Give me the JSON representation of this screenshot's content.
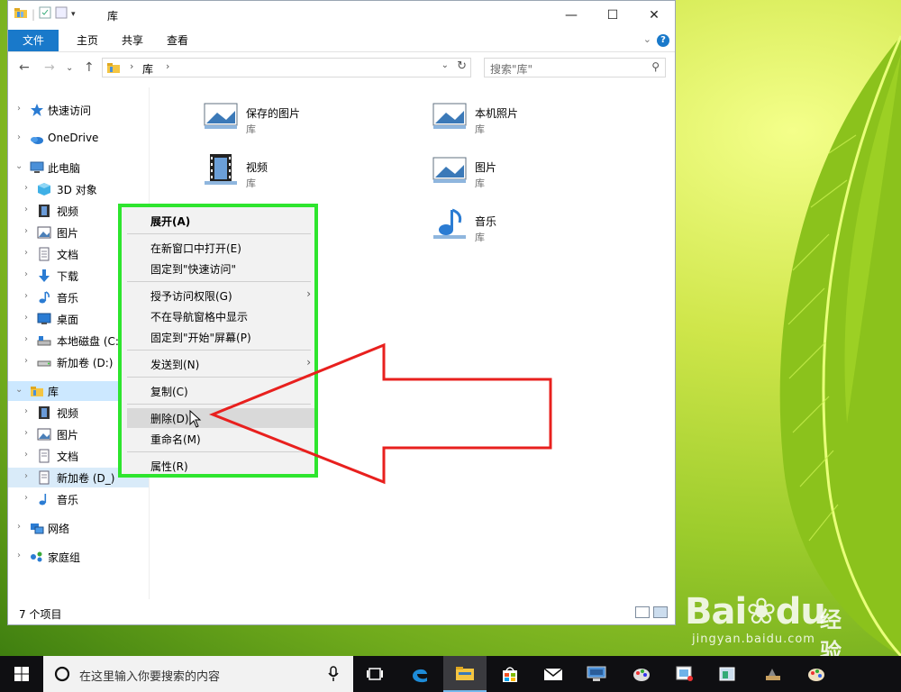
{
  "window": {
    "title": "库",
    "buttons": [
      "—",
      "☐",
      "✕"
    ]
  },
  "ribbon": {
    "tabs": [
      "文件",
      "主页",
      "共享",
      "查看"
    ]
  },
  "address": {
    "path": "库",
    "search_placeholder": "搜索\"库\""
  },
  "nav": {
    "items": [
      {
        "label": "快速访问",
        "icon": "star-icon"
      },
      {
        "label": "OneDrive",
        "icon": "cloud-icon"
      },
      {
        "label": "此电脑",
        "icon": "computer-icon"
      },
      {
        "label": "3D 对象",
        "icon": "cube-icon"
      },
      {
        "label": "视频",
        "icon": "film-icon"
      },
      {
        "label": "图片",
        "icon": "picture-icon"
      },
      {
        "label": "文档",
        "icon": "document-icon"
      },
      {
        "label": "下载",
        "icon": "download-icon"
      },
      {
        "label": "音乐",
        "icon": "music-icon"
      },
      {
        "label": "桌面",
        "icon": "desktop-icon"
      },
      {
        "label": "本地磁盘 (C:",
        "icon": "disk-icon"
      },
      {
        "label": "新加卷 (D:)",
        "icon": "drive-icon"
      },
      {
        "label": "库",
        "icon": "library-icon"
      },
      {
        "label": "视频",
        "icon": "film-icon"
      },
      {
        "label": "图片",
        "icon": "picture-icon"
      },
      {
        "label": "文档",
        "icon": "document-icon"
      },
      {
        "label": "新加卷 (D_)",
        "icon": "document-icon"
      },
      {
        "label": "音乐",
        "icon": "music-icon"
      },
      {
        "label": "网络",
        "icon": "network-icon"
      },
      {
        "label": "家庭组",
        "icon": "homegroup-icon"
      }
    ]
  },
  "content": {
    "tiles": [
      {
        "name": "保存的图片",
        "sub": "库",
        "icon": "picture-icon"
      },
      {
        "name": "本机照片",
        "sub": "库",
        "icon": "picture-icon"
      },
      {
        "name": "视频",
        "sub": "库",
        "icon": "film-icon"
      },
      {
        "name": "图片",
        "sub": "库",
        "icon": "picture-icon"
      },
      {
        "name": "音乐",
        "sub": "库",
        "icon": "music-icon"
      }
    ]
  },
  "status": {
    "count": "7 个项目"
  },
  "context_menu": {
    "items": [
      {
        "label": "展开(A)",
        "bold": true
      },
      {
        "label": "在新窗口中打开(E)"
      },
      {
        "label": "固定到\"快速访问\""
      },
      {
        "label": "授予访问权限(G)",
        "submenu": true
      },
      {
        "label": "不在导航窗格中显示"
      },
      {
        "label": "固定到\"开始\"屏幕(P)"
      },
      {
        "label": "发送到(N)",
        "submenu": true
      },
      {
        "label": "复制(C)"
      },
      {
        "label": "删除(D)",
        "hover": true
      },
      {
        "label": "重命名(M)"
      },
      {
        "label": "属性(R)"
      }
    ]
  },
  "taskbar": {
    "search_placeholder": "在这里输入你要搜索的内容"
  },
  "watermark": {
    "brand": "Bai",
    "brand_suffix": "du",
    "cn": "经验",
    "url": "jingyan.baidu.com"
  },
  "colors": {
    "accent": "#1979ca",
    "highlight_box": "#2ee52e",
    "arrow": "#e8201e",
    "selection": "#cce8ff"
  }
}
